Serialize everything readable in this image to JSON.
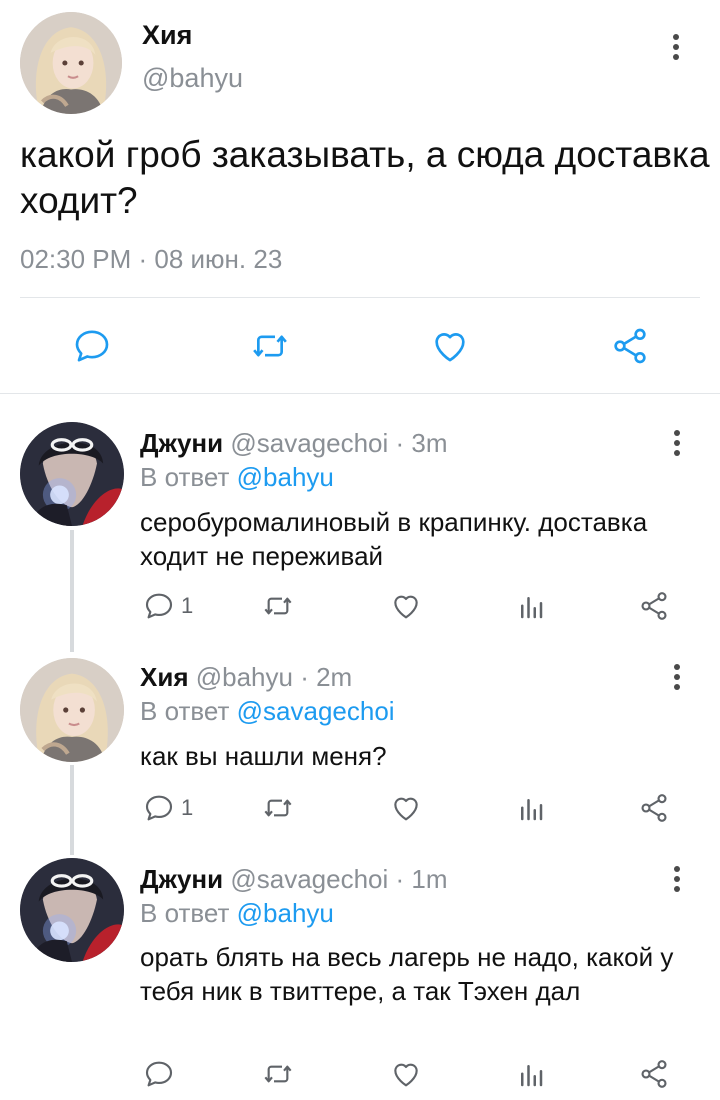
{
  "main_tweet": {
    "author_name": "Хия",
    "handle": "@bahyu",
    "text": "какой гроб заказывать, а сюда доставка ходит?",
    "timestamp": "02:30 PM · 08 июн. 23"
  },
  "replies": [
    {
      "author_name": "Джуни",
      "handle": "@savagechoi",
      "time": "· 3m",
      "reply_prefix": "В ответ",
      "reply_to": "@bahyu",
      "text": "серобуромалиновый в крапинку. доставка ходит не переживай",
      "comment_count": "1"
    },
    {
      "author_name": "Хия",
      "handle": "@bahyu",
      "time": "· 2m",
      "reply_prefix": "В ответ",
      "reply_to": "@savagechoi",
      "text": "как вы нашли меня?",
      "comment_count": "1"
    },
    {
      "author_name": "Джуни",
      "handle": "@savagechoi",
      "time": "· 1m",
      "reply_prefix": "В ответ",
      "reply_to": "@bahyu",
      "text": "орать блять на весь лагерь не надо, какой у тебя ник в твиттере, а так Тэхен дал",
      "comment_count": ""
    }
  ],
  "icons": {
    "comment": "comment-icon",
    "retweet": "retweet-icon",
    "like": "heart-icon",
    "share": "share-icon",
    "analytics": "analytics-icon",
    "more": "more-vertical-icon"
  },
  "colors": {
    "link": "#1d9bf0",
    "muted": "#8a8f95",
    "thread_line": "#d7dadd"
  }
}
